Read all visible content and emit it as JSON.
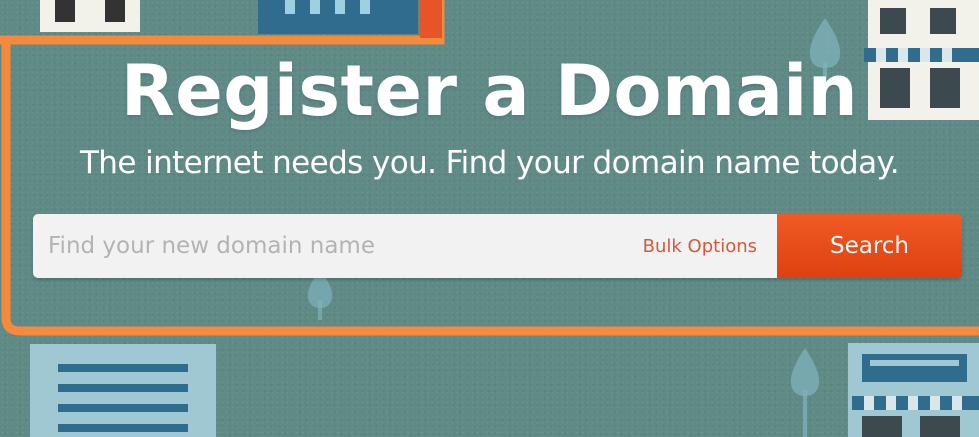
{
  "hero": {
    "title": "Register a Domain",
    "subtitle": "The internet needs you. Find your domain name today."
  },
  "search": {
    "placeholder": "Find your new domain name",
    "value": "",
    "bulk_options_label": "Bulk Options",
    "button_label": "Search"
  },
  "colors": {
    "background": "#5f8a86",
    "accent_orange": "#f05a24",
    "frame_orange": "#f58a3d",
    "building_blue": "#2f6c8d",
    "bulk_options_text": "#d15a3a",
    "input_background": "#f2f2f2"
  }
}
